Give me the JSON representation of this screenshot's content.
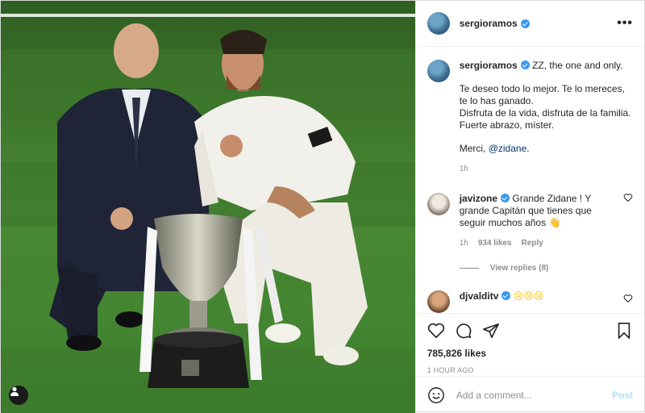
{
  "photo": {
    "description_icon": "user-tag-icon"
  },
  "header": {
    "username": "sergioramos",
    "more_label": "•••"
  },
  "caption": {
    "username": "sergioramos",
    "first_line": "ZZ, the one and only.",
    "body": "Te deseo todo lo mejor. Te lo mereces, te lo has ganado.\nDisfruta de la vida, disfruta de la familia. Fuerte abrazo, míster.",
    "closing": "Merci, ",
    "mention": "@zidane",
    "closing_end": ".",
    "time": "1h"
  },
  "comments": [
    {
      "username": "javizone",
      "text": "Grande Zidane ! Y grande Capitán que tienes que seguir muchos años",
      "emoji": "👋",
      "time": "1h",
      "likes": "934 likes",
      "reply": "Reply",
      "view_replies": "View replies (8)"
    },
    {
      "username": "djvalditv",
      "text": "",
      "emoji": "😢😢😢"
    }
  ],
  "actions": {
    "likes": "785,826 likes",
    "posted": "1 HOUR AGO"
  },
  "add_comment": {
    "placeholder": "Add a comment...",
    "post_label": "Post"
  },
  "colors": {
    "accent": "#3897f0",
    "post_button": "#b2dffc",
    "muted": "#8e8e8e",
    "pitch": "#3f7a2e"
  }
}
